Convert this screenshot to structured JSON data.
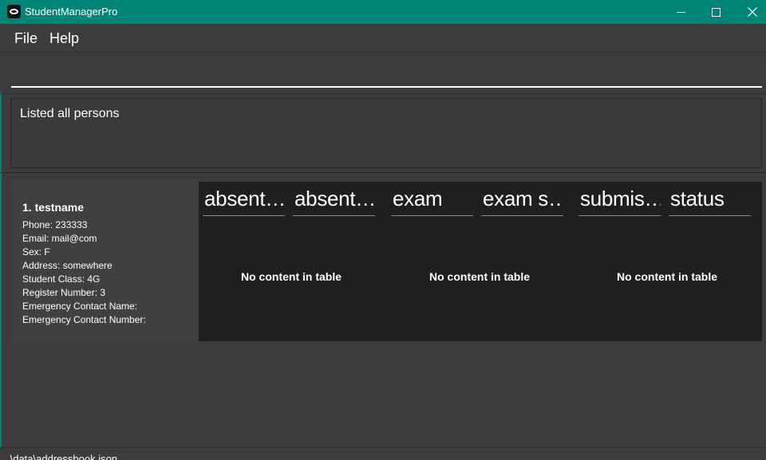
{
  "window": {
    "title": "StudentManagerPro"
  },
  "menu": {
    "file": "File",
    "help": "Help"
  },
  "command": {
    "value": "",
    "placeholder": ""
  },
  "result": {
    "message": "Listed all persons"
  },
  "person": {
    "name": "1. testname",
    "fields": [
      "Phone: 233333",
      "Email: mail@com",
      "Sex: F",
      "Address: somewhere",
      "Student Class: 4G",
      "Register Number: 3",
      "Emergency Contact Name:",
      "Emergency Contact Number:"
    ]
  },
  "tables": [
    {
      "headers": [
        "absent…",
        "absent…"
      ],
      "empty_message": "No content in table"
    },
    {
      "headers": [
        "exam",
        "exam s…"
      ],
      "empty_message": "No content in table"
    },
    {
      "headers": [
        "submis…",
        "status"
      ],
      "empty_message": "No content in table"
    }
  ],
  "status_bar": {
    "path": ".\\data\\addressbook.json"
  },
  "colors": {
    "titlebar": "#008576",
    "background": "#3c3c3c",
    "card": "#3f4042",
    "table_bg": "#1f1f1f"
  },
  "icons": {
    "app": "app-logo-icon",
    "minimize": "minimize-icon",
    "maximize": "maximize-icon",
    "close": "close-icon"
  }
}
